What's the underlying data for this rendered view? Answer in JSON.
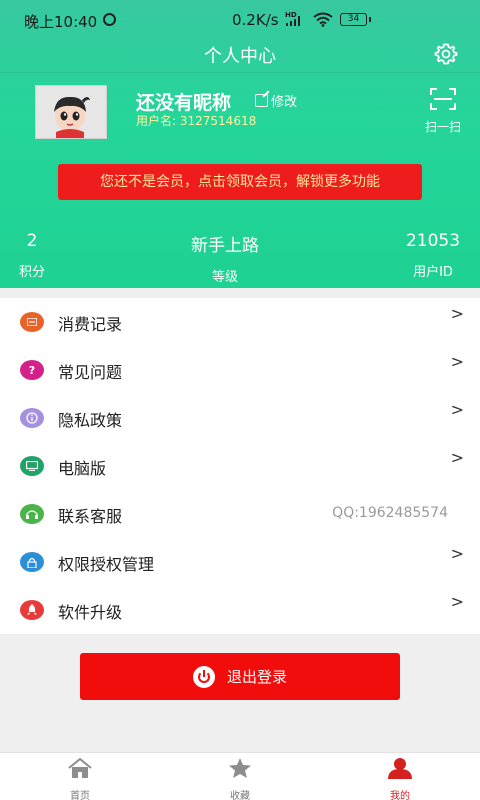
{
  "status_bar": {
    "time": "晚上10:40",
    "network_speed": "0.2K/s",
    "signal_label": "HD",
    "battery": "34"
  },
  "header": {
    "title": "个人中心"
  },
  "profile": {
    "nickname": "还没有昵称",
    "edit_label": "修改",
    "user_id_prefix": "用户名:",
    "user_id": "3127514618",
    "scan_label": "扫一扫"
  },
  "member_banner": {
    "text": "您还不是会员，点击领取会员，解锁更多功能"
  },
  "stats": {
    "points_value": "2",
    "points_label": "积分",
    "level_value": "新手上路",
    "level_label": "等级",
    "uid_value": "21053",
    "uid_label": "用户ID"
  },
  "menu": {
    "items": [
      {
        "label": "消费记录",
        "icon": "receipt-icon",
        "color": "#e8622a",
        "chevron": ">"
      },
      {
        "label": "常见问题",
        "icon": "question-icon",
        "color": "#d4208a",
        "chevron": ">"
      },
      {
        "label": "隐私政策",
        "icon": "info-icon",
        "color": "#a58fe0",
        "chevron": ">"
      },
      {
        "label": "电脑版",
        "icon": "computer-icon",
        "color": "#23a267",
        "chevron": ">"
      },
      {
        "label": "联系客服",
        "icon": "headset-icon",
        "color": "#4ab34a",
        "value": "QQ:1962485574"
      },
      {
        "label": "权限授权管理",
        "icon": "lock-icon",
        "color": "#2b8fd8",
        "chevron": ">"
      },
      {
        "label": "软件升级",
        "icon": "rocket-icon",
        "color": "#e83a3a",
        "chevron": ">"
      }
    ]
  },
  "logout": {
    "label": "退出登录"
  },
  "tabbar": {
    "tabs": [
      {
        "label": "首页",
        "icon": "home-icon"
      },
      {
        "label": "收藏",
        "icon": "star-icon"
      },
      {
        "label": "我的",
        "icon": "user-icon",
        "active": true
      }
    ]
  },
  "colors": {
    "header_gradient_top": "#38c8a0",
    "header_gradient_bottom": "#1ed293",
    "accent_red": "#f20d0d",
    "banner_text": "#ffe89a"
  }
}
